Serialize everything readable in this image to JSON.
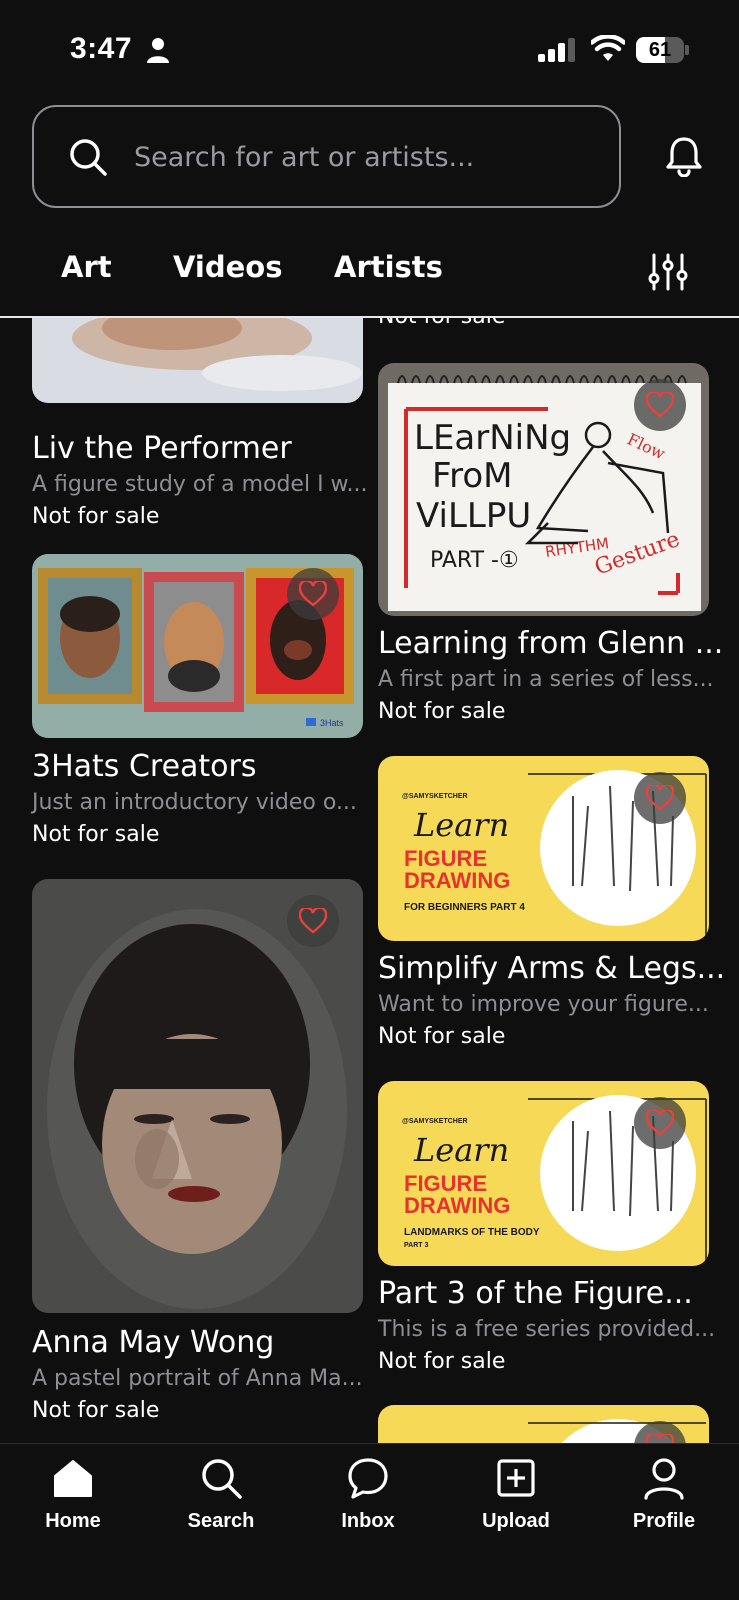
{
  "status_bar": {
    "time": "3:47",
    "battery": "61",
    "battery_level": 0.61
  },
  "search": {
    "placeholder": "Search for art or artists..."
  },
  "tabs": [
    {
      "label": "Art"
    },
    {
      "label": "Videos"
    },
    {
      "label": "Artists"
    }
  ],
  "left_column": [
    {
      "title": "Liv the Performer",
      "description": "A figure study of a model I w...",
      "sale": "Not for sale"
    },
    {
      "title": "3Hats Creators",
      "description": "Just an introductory video o...",
      "sale": "Not for sale",
      "thumb_brand": "3Hats"
    },
    {
      "title": "Anna May Wong",
      "description": "A pastel portrait of Anna Ma...",
      "sale": "Not for sale"
    }
  ],
  "right_column": [
    {
      "sale": "Not for sale"
    },
    {
      "title": "Learning from Glenn ...",
      "description": "A first part in a series of less...",
      "sale": "Not for sale",
      "thumb_text": [
        "LEarNiNg",
        "FroM",
        "ViLLPU",
        "PART -①",
        "RHYTHM",
        "Gesture",
        "Flow"
      ]
    },
    {
      "title": "Simplify Arms & Legs...",
      "description": "Want to improve your figure...",
      "sale": "Not for sale",
      "thumb_text": [
        "@SAMYSKETCHER",
        "Learn",
        "FIGURE",
        "DRAWING",
        "FOR BEGINNERS PART 4"
      ]
    },
    {
      "title": "Part 3 of the Figure...",
      "description": "This is a free series provided...",
      "sale": "Not for sale",
      "thumb_text": [
        "@SAMYSKETCHER",
        "Learn",
        "FIGURE",
        "DRAWING",
        "LANDMARKS OF THE BODY",
        "PART 3"
      ]
    }
  ],
  "bottom_nav": [
    {
      "label": "Home",
      "icon": "home-icon"
    },
    {
      "label": "Search",
      "icon": "search-icon"
    },
    {
      "label": "Inbox",
      "icon": "chat-bubble-icon"
    },
    {
      "label": "Upload",
      "icon": "plus-square-icon"
    },
    {
      "label": "Profile",
      "icon": "person-icon"
    }
  ],
  "colors": {
    "background": "#0f0f10",
    "muted_text": "#8e8e93",
    "heart": "#e8433a",
    "thumb_yellow": "#f7d958"
  }
}
